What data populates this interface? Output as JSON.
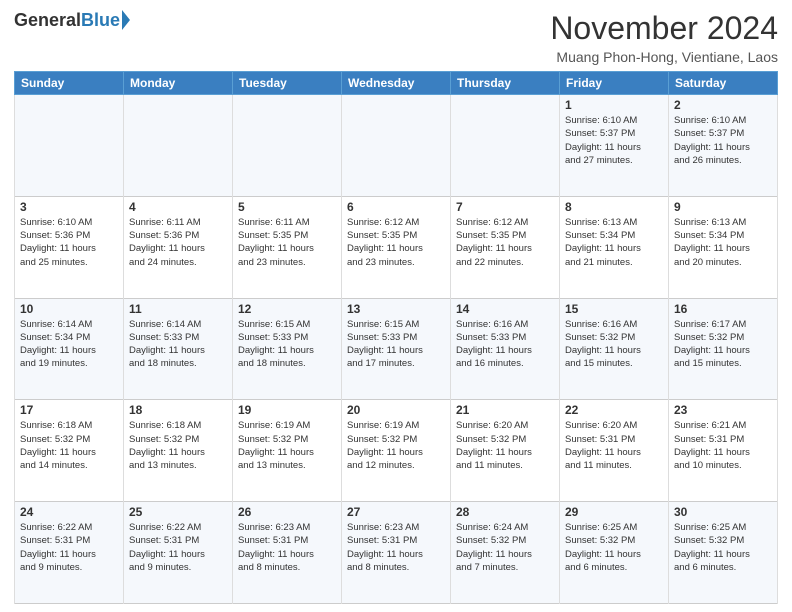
{
  "logo": {
    "general": "General",
    "blue": "Blue"
  },
  "title": "November 2024",
  "location": "Muang Phon-Hong, Vientiane, Laos",
  "weekdays": [
    "Sunday",
    "Monday",
    "Tuesday",
    "Wednesday",
    "Thursday",
    "Friday",
    "Saturday"
  ],
  "weeks": [
    [
      {
        "day": "",
        "info": ""
      },
      {
        "day": "",
        "info": ""
      },
      {
        "day": "",
        "info": ""
      },
      {
        "day": "",
        "info": ""
      },
      {
        "day": "",
        "info": ""
      },
      {
        "day": "1",
        "info": "Sunrise: 6:10 AM\nSunset: 5:37 PM\nDaylight: 11 hours\nand 27 minutes."
      },
      {
        "day": "2",
        "info": "Sunrise: 6:10 AM\nSunset: 5:37 PM\nDaylight: 11 hours\nand 26 minutes."
      }
    ],
    [
      {
        "day": "3",
        "info": "Sunrise: 6:10 AM\nSunset: 5:36 PM\nDaylight: 11 hours\nand 25 minutes."
      },
      {
        "day": "4",
        "info": "Sunrise: 6:11 AM\nSunset: 5:36 PM\nDaylight: 11 hours\nand 24 minutes."
      },
      {
        "day": "5",
        "info": "Sunrise: 6:11 AM\nSunset: 5:35 PM\nDaylight: 11 hours\nand 23 minutes."
      },
      {
        "day": "6",
        "info": "Sunrise: 6:12 AM\nSunset: 5:35 PM\nDaylight: 11 hours\nand 23 minutes."
      },
      {
        "day": "7",
        "info": "Sunrise: 6:12 AM\nSunset: 5:35 PM\nDaylight: 11 hours\nand 22 minutes."
      },
      {
        "day": "8",
        "info": "Sunrise: 6:13 AM\nSunset: 5:34 PM\nDaylight: 11 hours\nand 21 minutes."
      },
      {
        "day": "9",
        "info": "Sunrise: 6:13 AM\nSunset: 5:34 PM\nDaylight: 11 hours\nand 20 minutes."
      }
    ],
    [
      {
        "day": "10",
        "info": "Sunrise: 6:14 AM\nSunset: 5:34 PM\nDaylight: 11 hours\nand 19 minutes."
      },
      {
        "day": "11",
        "info": "Sunrise: 6:14 AM\nSunset: 5:33 PM\nDaylight: 11 hours\nand 18 minutes."
      },
      {
        "day": "12",
        "info": "Sunrise: 6:15 AM\nSunset: 5:33 PM\nDaylight: 11 hours\nand 18 minutes."
      },
      {
        "day": "13",
        "info": "Sunrise: 6:15 AM\nSunset: 5:33 PM\nDaylight: 11 hours\nand 17 minutes."
      },
      {
        "day": "14",
        "info": "Sunrise: 6:16 AM\nSunset: 5:33 PM\nDaylight: 11 hours\nand 16 minutes."
      },
      {
        "day": "15",
        "info": "Sunrise: 6:16 AM\nSunset: 5:32 PM\nDaylight: 11 hours\nand 15 minutes."
      },
      {
        "day": "16",
        "info": "Sunrise: 6:17 AM\nSunset: 5:32 PM\nDaylight: 11 hours\nand 15 minutes."
      }
    ],
    [
      {
        "day": "17",
        "info": "Sunrise: 6:18 AM\nSunset: 5:32 PM\nDaylight: 11 hours\nand 14 minutes."
      },
      {
        "day": "18",
        "info": "Sunrise: 6:18 AM\nSunset: 5:32 PM\nDaylight: 11 hours\nand 13 minutes."
      },
      {
        "day": "19",
        "info": "Sunrise: 6:19 AM\nSunset: 5:32 PM\nDaylight: 11 hours\nand 13 minutes."
      },
      {
        "day": "20",
        "info": "Sunrise: 6:19 AM\nSunset: 5:32 PM\nDaylight: 11 hours\nand 12 minutes."
      },
      {
        "day": "21",
        "info": "Sunrise: 6:20 AM\nSunset: 5:32 PM\nDaylight: 11 hours\nand 11 minutes."
      },
      {
        "day": "22",
        "info": "Sunrise: 6:20 AM\nSunset: 5:31 PM\nDaylight: 11 hours\nand 11 minutes."
      },
      {
        "day": "23",
        "info": "Sunrise: 6:21 AM\nSunset: 5:31 PM\nDaylight: 11 hours\nand 10 minutes."
      }
    ],
    [
      {
        "day": "24",
        "info": "Sunrise: 6:22 AM\nSunset: 5:31 PM\nDaylight: 11 hours\nand 9 minutes."
      },
      {
        "day": "25",
        "info": "Sunrise: 6:22 AM\nSunset: 5:31 PM\nDaylight: 11 hours\nand 9 minutes."
      },
      {
        "day": "26",
        "info": "Sunrise: 6:23 AM\nSunset: 5:31 PM\nDaylight: 11 hours\nand 8 minutes."
      },
      {
        "day": "27",
        "info": "Sunrise: 6:23 AM\nSunset: 5:31 PM\nDaylight: 11 hours\nand 8 minutes."
      },
      {
        "day": "28",
        "info": "Sunrise: 6:24 AM\nSunset: 5:32 PM\nDaylight: 11 hours\nand 7 minutes."
      },
      {
        "day": "29",
        "info": "Sunrise: 6:25 AM\nSunset: 5:32 PM\nDaylight: 11 hours\nand 6 minutes."
      },
      {
        "day": "30",
        "info": "Sunrise: 6:25 AM\nSunset: 5:32 PM\nDaylight: 11 hours\nand 6 minutes."
      }
    ]
  ]
}
